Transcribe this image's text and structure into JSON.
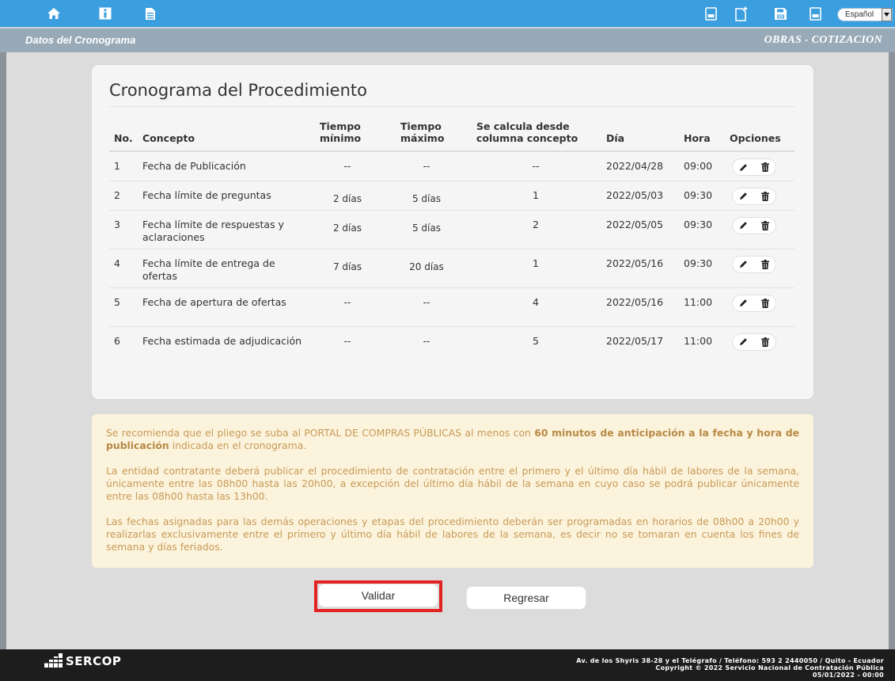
{
  "toolbar": {
    "language": "Español",
    "icons": [
      "home-icon",
      "info-icon",
      "document-icon",
      "pdf-icon",
      "new-document-icon",
      "save-icon",
      "pdf-icon"
    ]
  },
  "titlebar": {
    "left": "Datos del Cronograma",
    "right": "OBRAS - COTIZACION"
  },
  "card": {
    "title": "Cronograma del Procedimiento",
    "columns": {
      "no": "No.",
      "concepto": "Concepto",
      "tmin": "Tiempo mínimo",
      "tmax": "Tiempo máximo",
      "calc": "Se calcula desde columna concepto",
      "dia": "Día",
      "hora": "Hora",
      "opciones": "Opciones"
    },
    "rows": [
      {
        "no": "1",
        "concepto": "Fecha de Publicación",
        "tmin": "--",
        "tmax": "--",
        "calc": "--",
        "dia": "2022/04/28",
        "hora": "09:00"
      },
      {
        "no": "2",
        "concepto": "Fecha límite de preguntas",
        "tmin": "2 días",
        "tmax": "5 días",
        "calc": "1",
        "dia": "2022/05/03",
        "hora": "09:30"
      },
      {
        "no": "3",
        "concepto": "Fecha límite de respuestas y aclaraciones",
        "tmin": "2 días",
        "tmax": "5 días",
        "calc": "2",
        "dia": "2022/05/05",
        "hora": "09:30"
      },
      {
        "no": "4",
        "concepto": "Fecha límite de entrega de ofertas",
        "tmin": "7 días",
        "tmax": "20 días",
        "calc": "1",
        "dia": "2022/05/16",
        "hora": "09:30"
      },
      {
        "no": "5",
        "concepto": "Fecha de apertura de ofertas",
        "tmin": "--",
        "tmax": "--",
        "calc": "4",
        "dia": "2022/05/16",
        "hora": "11:00"
      },
      {
        "no": "6",
        "concepto": "Fecha estimada de adjudicación",
        "tmin": "--",
        "tmax": "--",
        "calc": "5",
        "dia": "2022/05/17",
        "hora": "11:00"
      }
    ]
  },
  "notice": {
    "p1_a": "Se recomienda que el pliego se suba al PORTAL DE COMPRAS PÚBLICAS al menos con ",
    "p1_bold": "60 minutos de anticipación a la fecha y hora de publicación",
    "p1_b": " indicada en el cronograma.",
    "p2": "La entidad contratante deberá publicar el procedimiento de contratación entre el primero y el último día hábil de labores de la semana, únicamente entre las 08h00 hasta las 20h00, a excepción del último día hábil de la semana en cuyo caso se podrá publicar únicamente entre las 08h00 hasta las 13h00.",
    "p3": "Las fechas asignadas para las demás operaciones y etapas del procedimiento deberán ser programadas en horarios de 08h00 a 20h00 y realizarlas exclusivamente entre el primero y último día hábil de labores de la semana, es decir no se tomaran en cuenta los fines de semana y días feriados."
  },
  "buttons": {
    "validar": "Validar",
    "regresar": "Regresar"
  },
  "footer": {
    "logo": "SERCOP",
    "line1": "Av. de los Shyris 38-28 y el Telégrafo / Teléfono: 593 2 2440050 / Quito - Ecuador",
    "line2": "Copyright © 2022 Servicio Nacional de Contratación Pública",
    "line3": "05/01/2022 - 00:00"
  },
  "colors": {
    "toolbar": "#3b9ede",
    "titlebar": "#98a9b7",
    "notice_bg": "#fcf3dd",
    "notice_text": "#c79a55",
    "highlight": "#e32222"
  }
}
